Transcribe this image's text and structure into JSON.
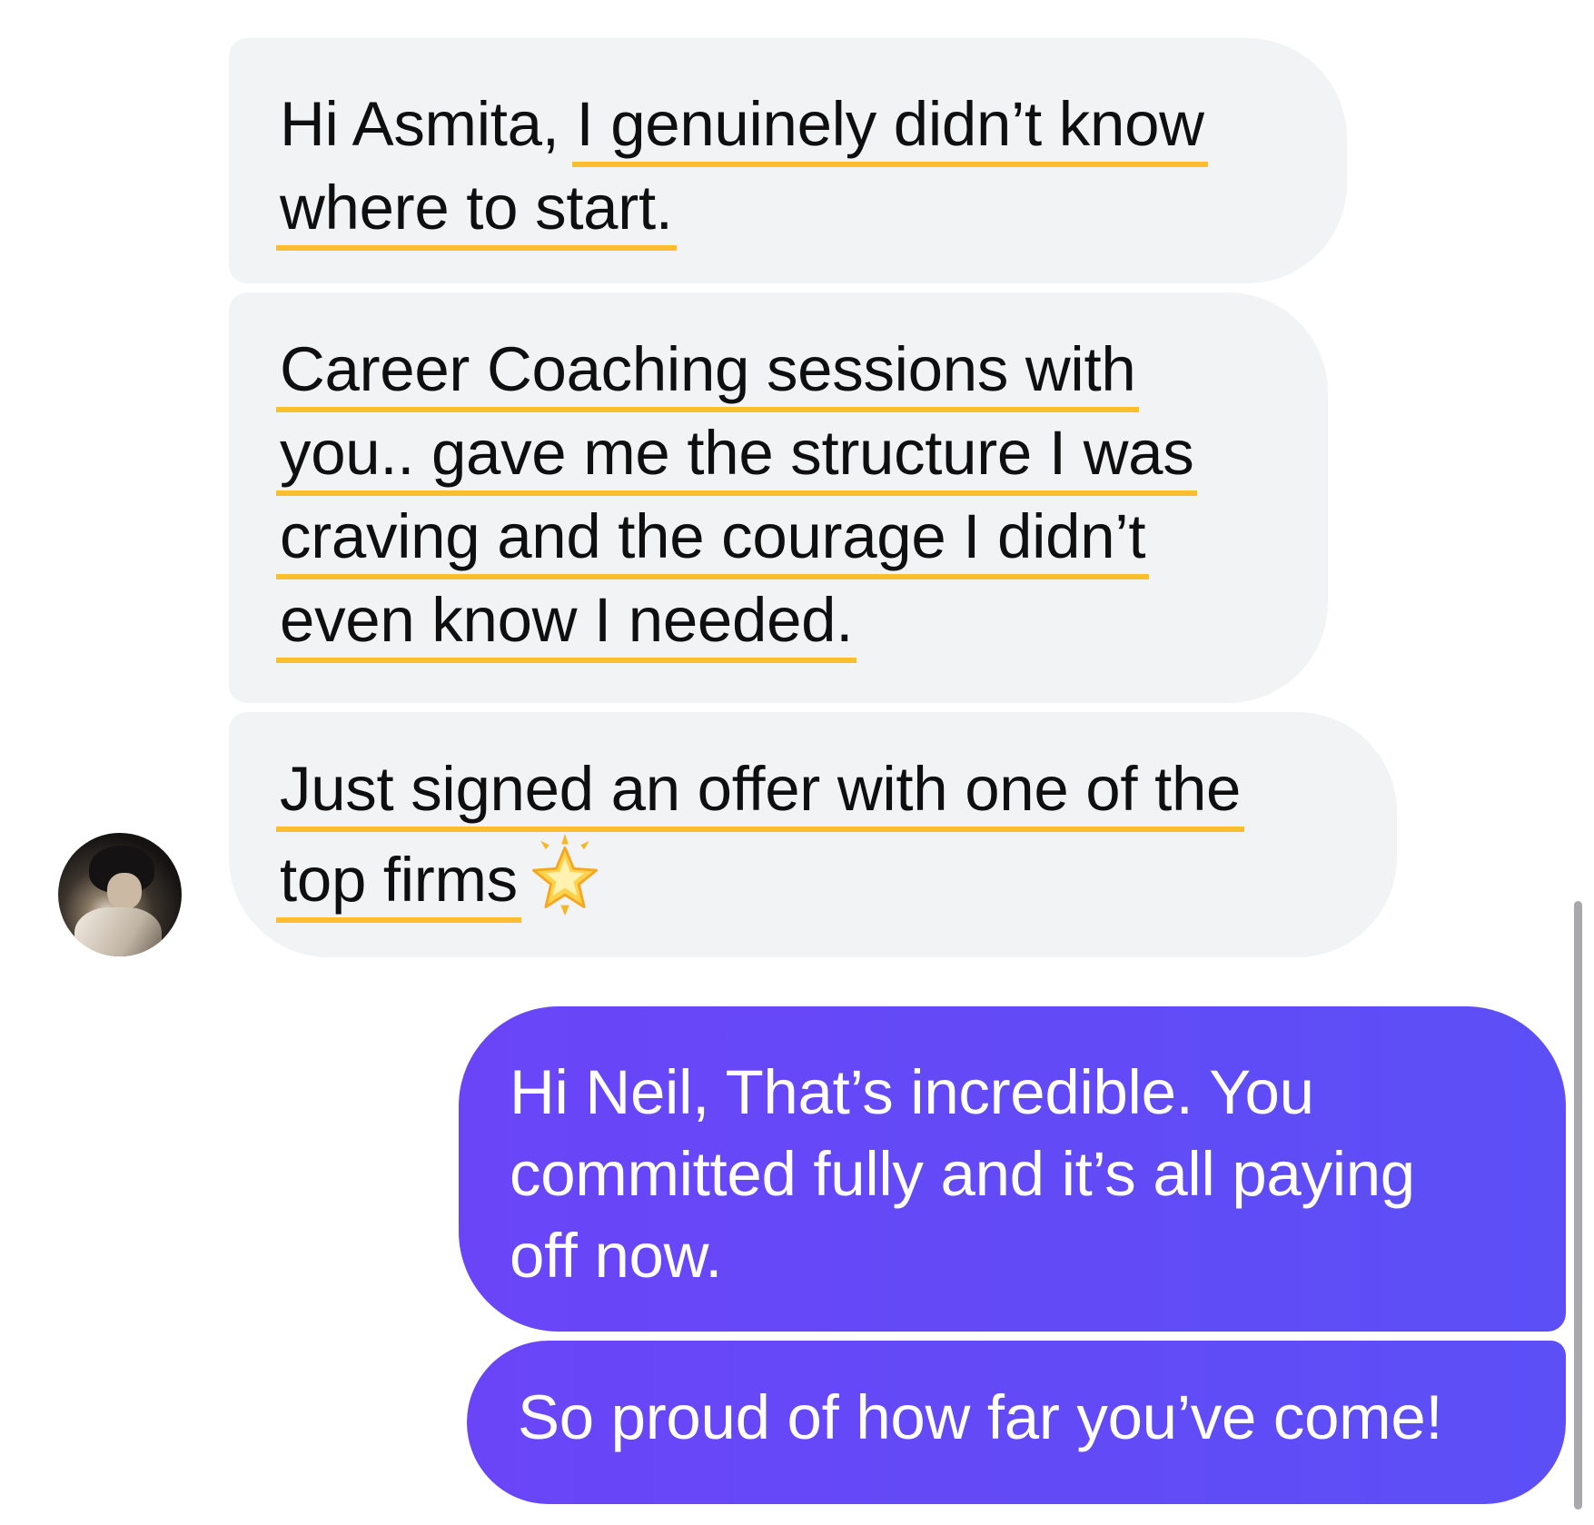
{
  "conversation": {
    "incoming": {
      "sender_avatar": "avatar",
      "messages": [
        {
          "lines": [
            "Hi Asmita, I genuinely didn’t know",
            "where to start."
          ]
        },
        {
          "lines": [
            "Career Coaching sessions with",
            "you.. gave me the structure I was",
            "craving and the courage I didn’t",
            "even know I needed."
          ]
        },
        {
          "lines": [
            "Just signed an offer with one of the",
            "top firms"
          ],
          "emoji": "glowing-star-emoji"
        }
      ]
    },
    "outgoing": {
      "messages": [
        {
          "lines": [
            "Hi Neil, That’s incredible. You",
            "committed fully and it’s all paying",
            "off now."
          ]
        },
        {
          "lines": [
            "So proud of how far you’ve come!"
          ]
        }
      ]
    }
  },
  "colors": {
    "incoming_bubble": "#f2f3f5",
    "outgoing_bubble": "#6246f7",
    "highlight_underline": "#fbbe2e",
    "text_dark": "#0f0f10",
    "text_light": "#ffffff"
  }
}
